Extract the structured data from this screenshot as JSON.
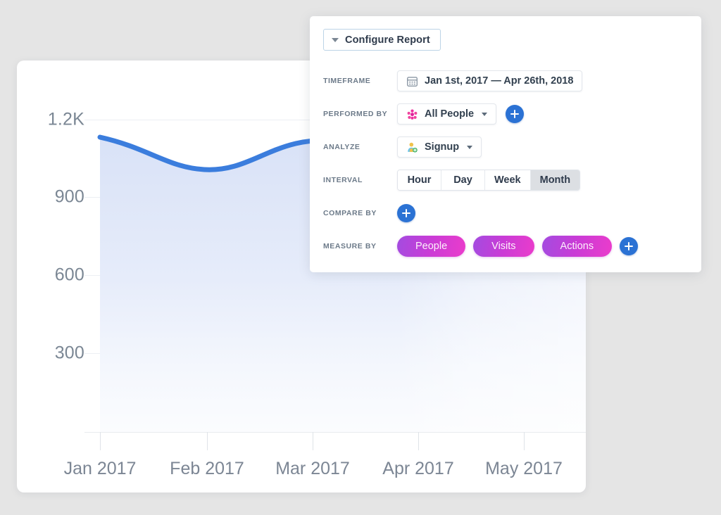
{
  "background_color": "#e5e5e5",
  "colors": {
    "accent_blue": "#2b72d4",
    "line_blue": "#3b7ddd",
    "pill_gradient_from": "#a34ce0",
    "pill_gradient_to": "#eb3ccb",
    "label_gray": "#6c7a89",
    "axis_text": "#7b8794",
    "segment_active_bg": "#dcdfe3"
  },
  "config_panel": {
    "configure_button": {
      "label": "Configure Report",
      "caret_icon": "chevron-down-icon"
    },
    "rows": [
      {
        "key": "timeframe",
        "label": "TIMEFRAME",
        "control": {
          "type": "date-range",
          "icon": "calendar-icon",
          "value": "Jan 1st, 2017 — Apr 26th, 2018"
        }
      },
      {
        "key": "performed_by",
        "label": "PERFORMED BY",
        "control": {
          "type": "select",
          "icon": "people-group-icon",
          "value": "All People",
          "caret_icon": "chevron-down-icon"
        },
        "add_button": {
          "icon": "plus-icon",
          "label": "+"
        }
      },
      {
        "key": "analyze",
        "label": "ANALYZE",
        "control": {
          "type": "select",
          "icon": "person-signup-icon",
          "value": "Signup",
          "caret_icon": "chevron-down-icon"
        }
      },
      {
        "key": "interval",
        "label": "INTERVAL",
        "control": {
          "type": "segmented",
          "options": [
            "Hour",
            "Day",
            "Week",
            "Month"
          ],
          "selected": "Month"
        }
      },
      {
        "key": "compare_by",
        "label": "COMPARE BY",
        "add_button": {
          "icon": "plus-icon",
          "label": "+"
        }
      },
      {
        "key": "measure_by",
        "label": "MEASURE BY",
        "pills": [
          "People",
          "Visits",
          "Actions"
        ],
        "add_button": {
          "icon": "plus-icon",
          "label": "+"
        }
      }
    ]
  },
  "chart_data": {
    "type": "area",
    "title": "",
    "xlabel": "",
    "ylabel": "",
    "grid": true,
    "legend": null,
    "ylim": [
      0,
      1320
    ],
    "ytick_labels": [
      "1.2K",
      "900",
      "600",
      "300"
    ],
    "ytick_values": [
      1200,
      900,
      600,
      300
    ],
    "xtick_labels": [
      "Jan 2017",
      "Feb 2017",
      "Mar 2017",
      "Apr 2017",
      "May 2017"
    ],
    "x": [
      "Jan 2017",
      "Feb 2017",
      "Mar 2017",
      "Apr 2017",
      "May 2017"
    ],
    "series": [
      {
        "name": "Signup",
        "color": "#3b7ddd",
        "values": [
          1085,
          965,
          1060,
          1070,
          1065
        ]
      }
    ]
  }
}
